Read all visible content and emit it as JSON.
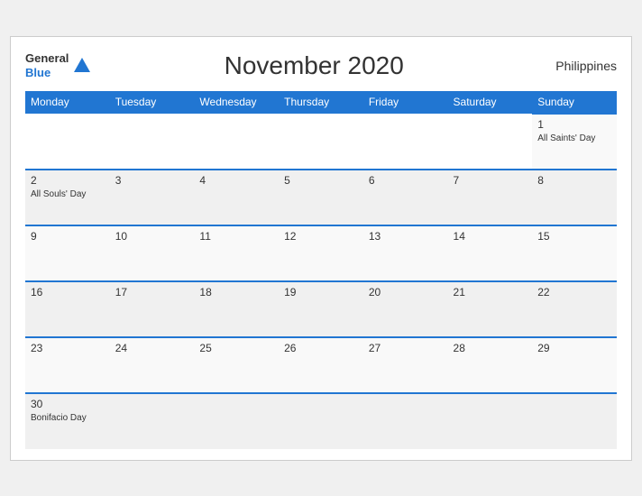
{
  "header": {
    "logo_general": "General",
    "logo_blue": "Blue",
    "title": "November 2020",
    "country": "Philippines"
  },
  "weekdays": [
    "Monday",
    "Tuesday",
    "Wednesday",
    "Thursday",
    "Friday",
    "Saturday",
    "Sunday"
  ],
  "weeks": [
    [
      {
        "day": "",
        "holiday": ""
      },
      {
        "day": "",
        "holiday": ""
      },
      {
        "day": "",
        "holiday": ""
      },
      {
        "day": "",
        "holiday": ""
      },
      {
        "day": "",
        "holiday": ""
      },
      {
        "day": "",
        "holiday": ""
      },
      {
        "day": "1",
        "holiday": "All Saints' Day"
      }
    ],
    [
      {
        "day": "2",
        "holiday": "All Souls' Day"
      },
      {
        "day": "3",
        "holiday": ""
      },
      {
        "day": "4",
        "holiday": ""
      },
      {
        "day": "5",
        "holiday": ""
      },
      {
        "day": "6",
        "holiday": ""
      },
      {
        "day": "7",
        "holiday": ""
      },
      {
        "day": "8",
        "holiday": ""
      }
    ],
    [
      {
        "day": "9",
        "holiday": ""
      },
      {
        "day": "10",
        "holiday": ""
      },
      {
        "day": "11",
        "holiday": ""
      },
      {
        "day": "12",
        "holiday": ""
      },
      {
        "day": "13",
        "holiday": ""
      },
      {
        "day": "14",
        "holiday": ""
      },
      {
        "day": "15",
        "holiday": ""
      }
    ],
    [
      {
        "day": "16",
        "holiday": ""
      },
      {
        "day": "17",
        "holiday": ""
      },
      {
        "day": "18",
        "holiday": ""
      },
      {
        "day": "19",
        "holiday": ""
      },
      {
        "day": "20",
        "holiday": ""
      },
      {
        "day": "21",
        "holiday": ""
      },
      {
        "day": "22",
        "holiday": ""
      }
    ],
    [
      {
        "day": "23",
        "holiday": ""
      },
      {
        "day": "24",
        "holiday": ""
      },
      {
        "day": "25",
        "holiday": ""
      },
      {
        "day": "26",
        "holiday": ""
      },
      {
        "day": "27",
        "holiday": ""
      },
      {
        "day": "28",
        "holiday": ""
      },
      {
        "day": "29",
        "holiday": ""
      }
    ],
    [
      {
        "day": "30",
        "holiday": "Bonifacio Day"
      },
      {
        "day": "",
        "holiday": ""
      },
      {
        "day": "",
        "holiday": ""
      },
      {
        "day": "",
        "holiday": ""
      },
      {
        "day": "",
        "holiday": ""
      },
      {
        "day": "",
        "holiday": ""
      },
      {
        "day": "",
        "holiday": ""
      }
    ]
  ]
}
